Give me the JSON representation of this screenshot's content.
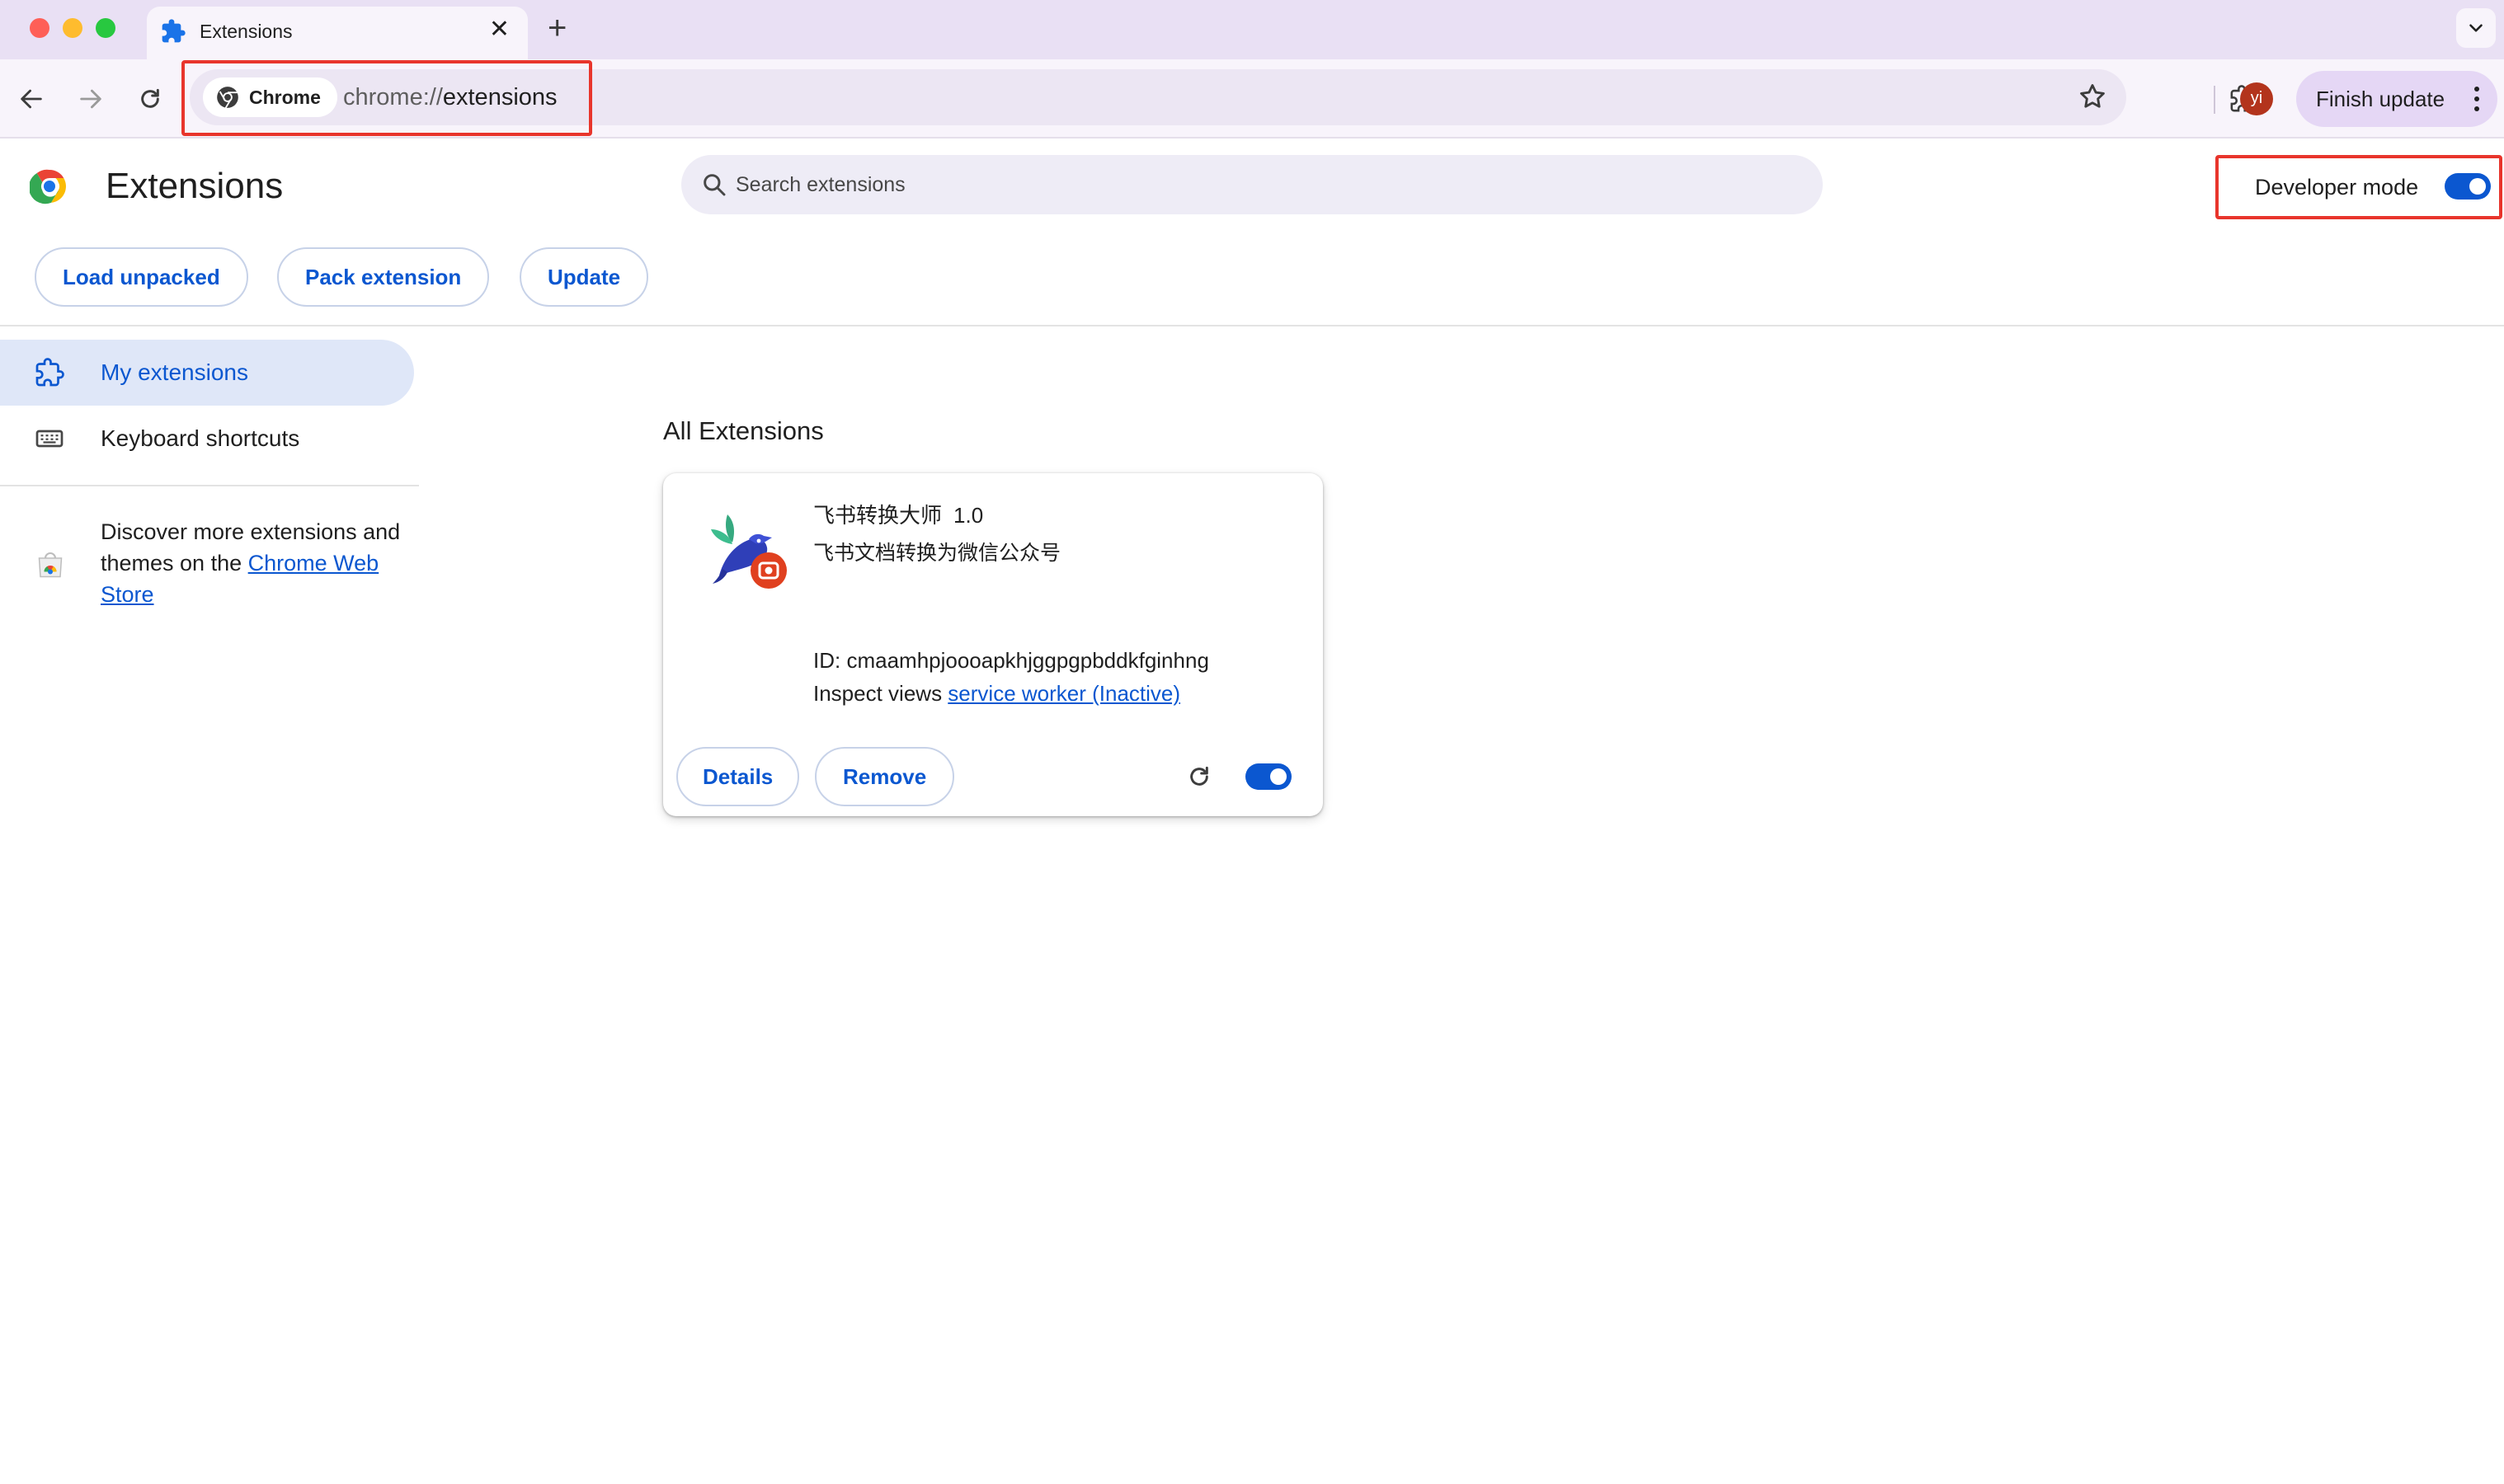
{
  "browser": {
    "tab": {
      "title": "Extensions",
      "close_glyph": "✕",
      "icon": "puzzle-icon"
    },
    "new_tab_glyph": "+",
    "omnibox": {
      "chip_label": "Chrome",
      "url_prefix": "chrome://",
      "url_host": "extensions"
    },
    "avatar_initials": "yi",
    "finish_update_label": "Finish update",
    "accent_color": "#0b57d0",
    "highlight_color": "#e8352c"
  },
  "page": {
    "title": "Extensions",
    "search_placeholder": "Search extensions",
    "developer_mode": {
      "label": "Developer mode",
      "enabled": true
    },
    "actions": {
      "load_unpacked": "Load unpacked",
      "pack_extension": "Pack extension",
      "update": "Update"
    }
  },
  "sidebar": {
    "items": [
      {
        "label": "My extensions",
        "icon": "extension-outline-icon",
        "active": true
      },
      {
        "label": "Keyboard shortcuts",
        "icon": "keyboard-icon",
        "active": false
      }
    ],
    "discover_text": "Discover more extensions and themes on the ",
    "webstore_link": "Chrome Web Store"
  },
  "main": {
    "section_title": "All Extensions",
    "extensions": [
      {
        "name": "飞书转换大师",
        "version": "1.0",
        "description": "飞书文档转换为微信公众号",
        "id_label": "ID: ",
        "id": "cmaamhpjoooapkhjggpgpbddkfginhng",
        "inspect_label": "Inspect views ",
        "inspect_link": "service worker (Inactive)",
        "details_label": "Details",
        "remove_label": "Remove",
        "enabled": true
      }
    ]
  }
}
